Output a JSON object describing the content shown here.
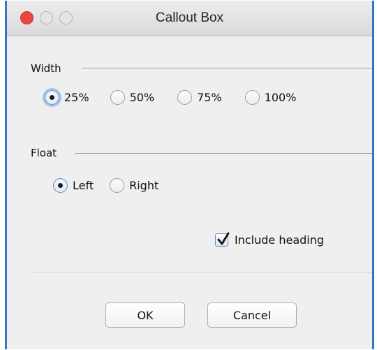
{
  "window": {
    "title": "Callout Box"
  },
  "width_group": {
    "label": "Width",
    "options": [
      {
        "label": "25%",
        "checked": true
      },
      {
        "label": "50%",
        "checked": false
      },
      {
        "label": "75%",
        "checked": false
      },
      {
        "label": "100%",
        "checked": false
      }
    ]
  },
  "float_group": {
    "label": "Float",
    "options": [
      {
        "label": "Left",
        "checked": true
      },
      {
        "label": "Right",
        "checked": false
      }
    ]
  },
  "include_heading": {
    "label": "Include heading",
    "checked": true
  },
  "buttons": {
    "ok_label": "OK",
    "cancel_label": "Cancel"
  },
  "colors": {
    "window_border": "#2f78c2",
    "close_button": "#e9473e",
    "focus_ring": "#64a0eb"
  },
  "icons": {
    "close": "close-icon",
    "minimize": "minimize-icon",
    "zoom": "zoom-icon",
    "checkmark": "checkmark-icon"
  }
}
